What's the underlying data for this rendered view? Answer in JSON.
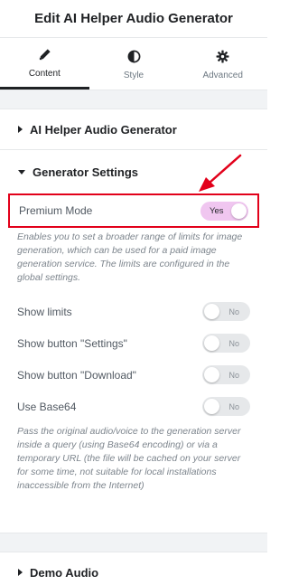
{
  "header": {
    "title": "Edit AI Helper Audio Generator"
  },
  "tabs": [
    {
      "label": "Content",
      "icon": "pencil-icon",
      "active": true
    },
    {
      "label": "Style",
      "icon": "half-circle-icon",
      "active": false
    },
    {
      "label": "Advanced",
      "icon": "gear-icon",
      "active": false
    }
  ],
  "sections": {
    "main": {
      "label": "AI Helper Audio Generator"
    },
    "generator": {
      "label": "Generator Settings",
      "premium": {
        "label": "Premium Mode",
        "toggle": "Yes",
        "description": "Enables you to set a broader range of limits for image generation, which can be used for a paid image generation service. The limits are configured in the global settings."
      },
      "show_limits": {
        "label": "Show limits",
        "toggle": "No"
      },
      "show_settings": {
        "label": "Show button \"Settings\"",
        "toggle": "No"
      },
      "show_download": {
        "label": "Show button \"Download\"",
        "toggle": "No"
      },
      "base64": {
        "label": "Use Base64",
        "toggle": "No",
        "description": "Pass the original audio/voice to the generation server inside a query (using Base64 encoding) or via a temporary URL (the file will be cached on your server for some time, not suitable for local installations inaccessible from the Internet)"
      }
    },
    "demo": {
      "label": "Demo Audio"
    }
  },
  "colors": {
    "highlight": "#e2001a",
    "toggle_on": "#f0c6f0",
    "toggle_off": "#e6e8ea"
  }
}
